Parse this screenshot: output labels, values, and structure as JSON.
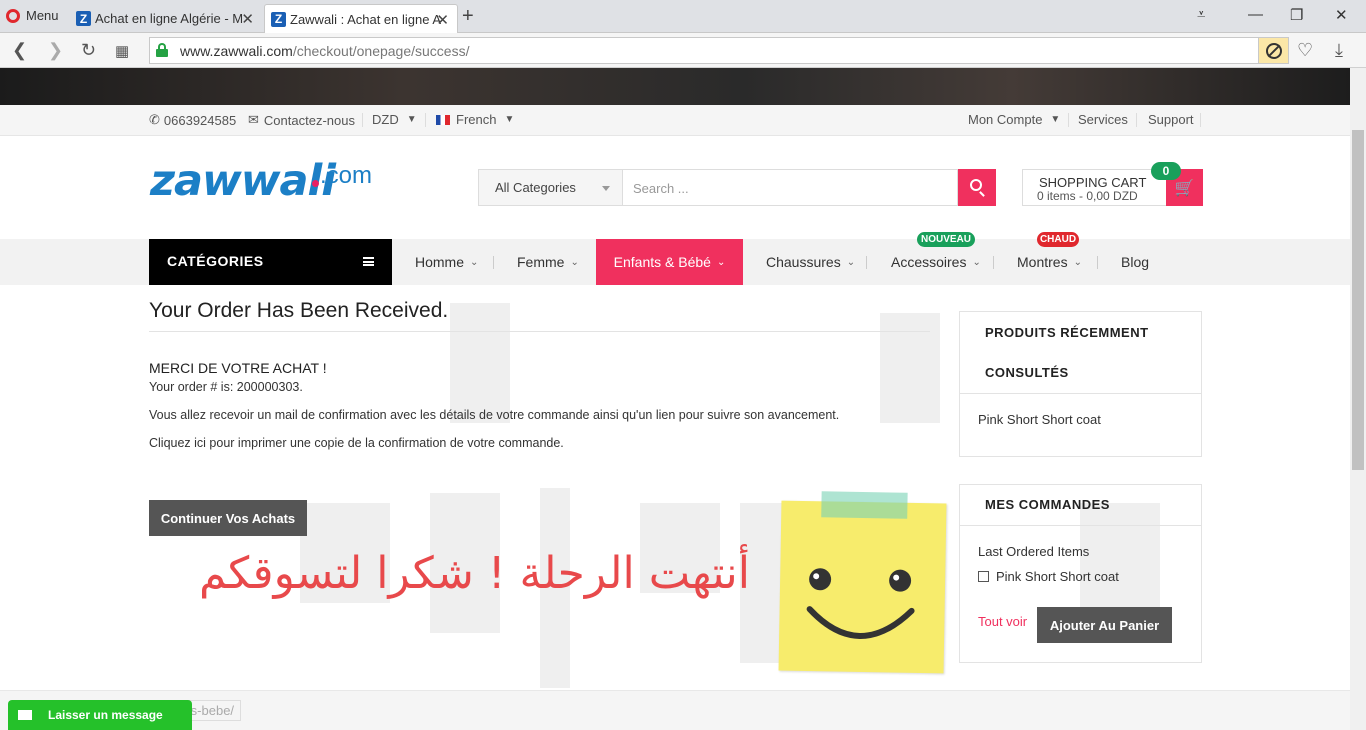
{
  "browser": {
    "menu_label": "Menu",
    "tabs": [
      {
        "title": "Achat en ligne Algérie - M",
        "favicon": "Z"
      },
      {
        "title": "Zawwali : Achat en ligne A",
        "favicon": "Z"
      }
    ],
    "url_domain": "www.zawwali.com",
    "url_path": "/checkout/onepage/success/"
  },
  "topbar": {
    "phone": "0663924585",
    "contact": "Contactez-nous",
    "currency": "DZD",
    "language": "French",
    "account": "Mon Compte",
    "services": "Services",
    "support": "Support"
  },
  "header": {
    "logo_word": "zawwali",
    "logo_suffix": ".com",
    "search_category": "All Categories",
    "search_placeholder": "Search ...",
    "cart_title": "SHOPPING CART",
    "cart_summary": "0 items - 0,00 DZD",
    "cart_count": "0"
  },
  "nav": {
    "categories_label": "CATÉGORIES",
    "items": [
      {
        "label": "Homme"
      },
      {
        "label": "Femme"
      },
      {
        "label": "Enfants & Bébé"
      },
      {
        "label": "Chaussures"
      },
      {
        "label": "Accessoires",
        "badge": "NOUVEAU"
      },
      {
        "label": "Montres",
        "badge": "CHAUD"
      },
      {
        "label": "Blog"
      }
    ],
    "accent_color": "#f0305e"
  },
  "main": {
    "title": "Your Order Has Been Received.",
    "merci": "MERCI DE VOTRE ACHAT !",
    "order_line": "Your order # is: 200000303.",
    "mail_line": "Vous allez recevoir un mail de confirmation avec les détails de votre commande ainsi qu'un lien pour suivre son avancement.",
    "print_line": "Cliquez ici pour imprimer une copie de la confirmation de votre commande.",
    "continue_label": "Continuer Vos Achats",
    "arabic_caption": "أنتهت الرحلة ! شكرا لتسوقكم"
  },
  "sidebar": {
    "recent_title_1": "PRODUITS RÉCEMMENT",
    "recent_title_2": "CONSULTÉS",
    "recent_item": "Pink Short Short coat",
    "orders_title": "MES COMMANDES",
    "last_ordered": "Last Ordered Items",
    "ordered_item": "Pink Short Short coat",
    "see_all": "Tout voir",
    "add_to_cart": "Ajouter Au Panier"
  },
  "footer": {
    "link_fragment": "fants-bebe/",
    "chat_label": "Laisser un message"
  }
}
